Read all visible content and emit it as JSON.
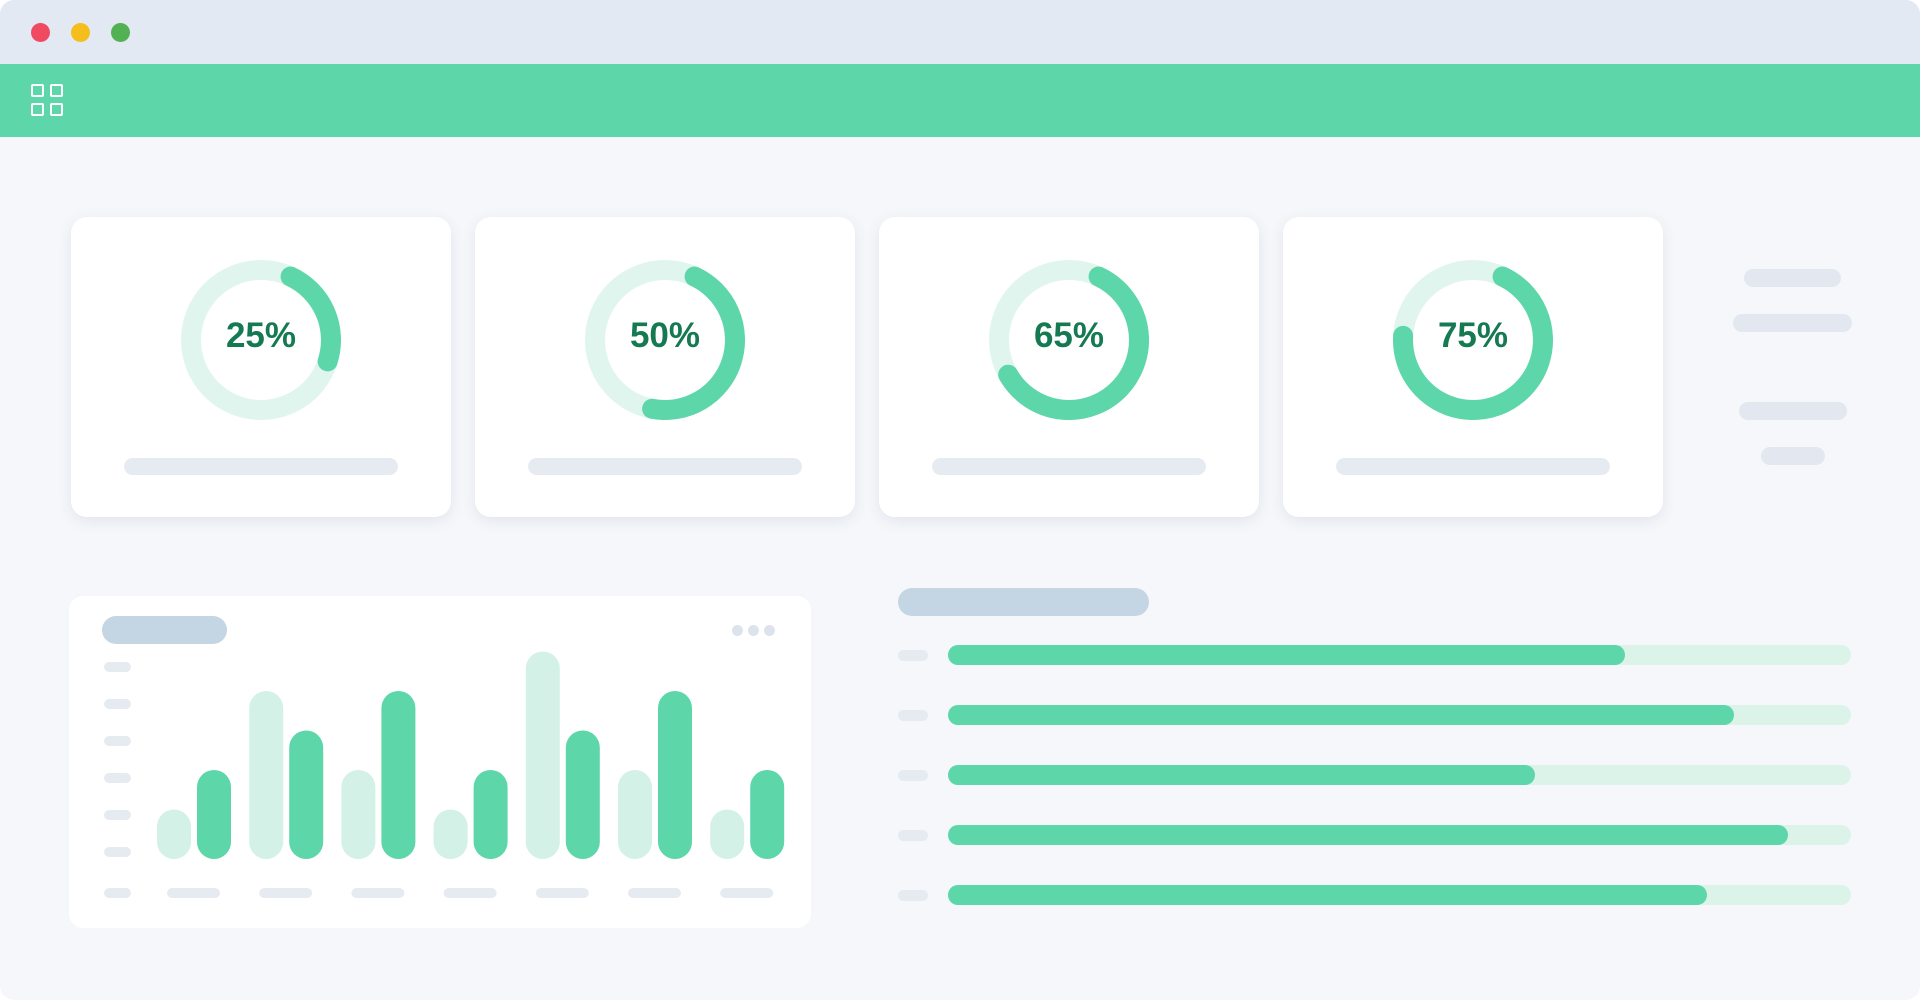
{
  "window": {
    "controls": [
      "close",
      "minimize",
      "maximize"
    ]
  },
  "toolbar": {
    "icon": "grid-icon"
  },
  "colors": {
    "accent": "#5dd6aa",
    "accent_light": "#d9f3e9",
    "percent_text": "#157a52",
    "placeholder": "#e6ebf2",
    "title_placeholder": "#c4d5e3"
  },
  "stats": [
    {
      "label": "25%",
      "value": 25
    },
    {
      "label": "50%",
      "value": 50
    },
    {
      "label": "65%",
      "value": 65
    },
    {
      "label": "75%",
      "value": 75
    }
  ],
  "chart_data": {
    "type": "bar",
    "title": "",
    "xlabel": "",
    "ylabel": "",
    "categories": [
      "",
      "",
      "",
      "",
      "",
      "",
      ""
    ],
    "ylim": [
      0,
      6
    ],
    "grid": false,
    "legend": "none",
    "series": [
      {
        "values": [
          1,
          4,
          2,
          1,
          5,
          2,
          1
        ],
        "color": "#d3f1e6"
      },
      {
        "values": [
          2,
          3,
          4,
          2,
          3,
          4,
          2
        ],
        "color": "#5dd6aa"
      }
    ]
  },
  "progress_list": [
    {
      "value": 0.75
    },
    {
      "value": 0.87
    },
    {
      "value": 0.65
    },
    {
      "value": 0.93
    },
    {
      "value": 0.84
    }
  ]
}
